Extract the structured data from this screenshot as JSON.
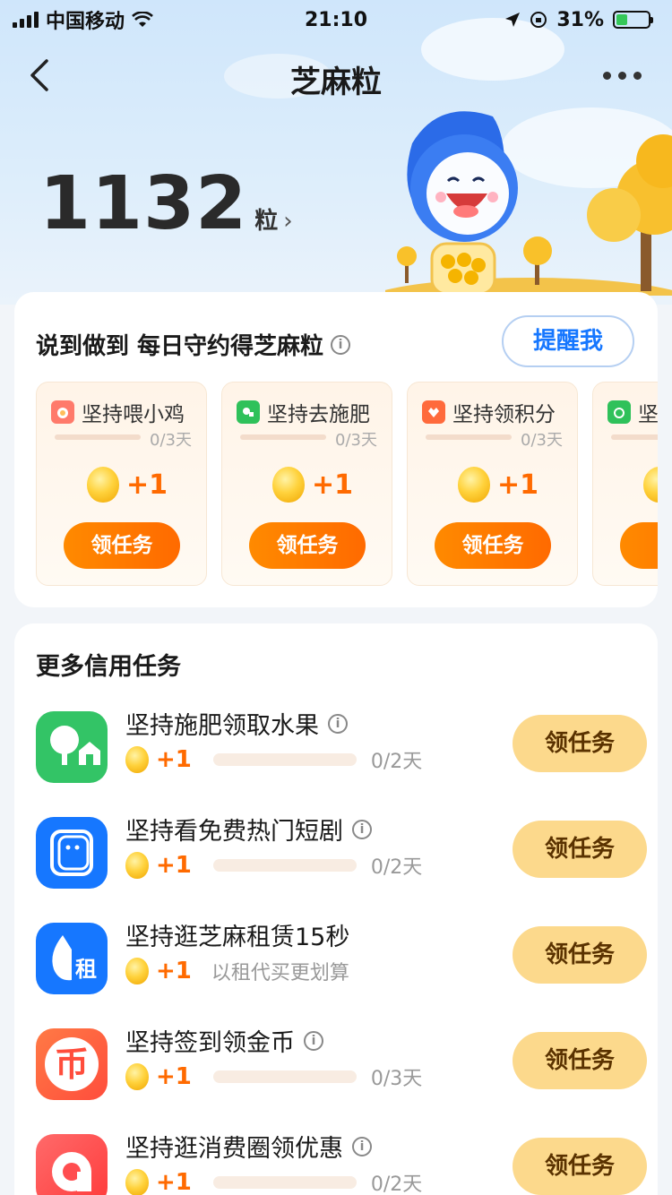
{
  "status_bar": {
    "carrier": "中国移动",
    "time": "21:10",
    "battery": "31%"
  },
  "nav": {
    "title": "芝麻粒"
  },
  "points": {
    "value": "1132",
    "unit": "粒"
  },
  "daily": {
    "title": "说到做到 每日守约得芝麻粒",
    "remind_label": "提醒我",
    "tasks": [
      {
        "name": "坚持喂小鸡",
        "progress": "0/3天",
        "reward": "+1",
        "button": "领任务"
      },
      {
        "name": "坚持去施肥",
        "progress": "0/3天",
        "reward": "+1",
        "button": "领任务"
      },
      {
        "name": "坚持领积分",
        "progress": "0/3天",
        "reward": "+1",
        "button": "领任务"
      },
      {
        "name": "坚",
        "progress": "",
        "reward": "",
        "button": "领"
      }
    ]
  },
  "more": {
    "title": "更多信用任务",
    "items": [
      {
        "title": "坚持施肥领取水果",
        "reward": "+1",
        "progress": "0/2天",
        "button": "领任务",
        "icon_color": "#33c466"
      },
      {
        "title": "坚持看免费热门短剧",
        "reward": "+1",
        "progress": "0/2天",
        "button": "领任务",
        "icon_color": "#1677ff"
      },
      {
        "title": "坚持逛芝麻租赁15秒",
        "reward": "+1",
        "desc": "以租代买更划算",
        "button": "领任务",
        "icon_color": "#1677ff",
        "icon_text": "租"
      },
      {
        "title": "坚持签到领金币",
        "reward": "+1",
        "progress": "0/3天",
        "button": "领任务",
        "icon_color": "#ff5a3c",
        "icon_text": "币"
      },
      {
        "title": "坚持逛消费圈领优惠",
        "reward": "+1",
        "progress": "0/2天",
        "button": "领任务",
        "icon_color": "#ff4d4f"
      }
    ]
  }
}
